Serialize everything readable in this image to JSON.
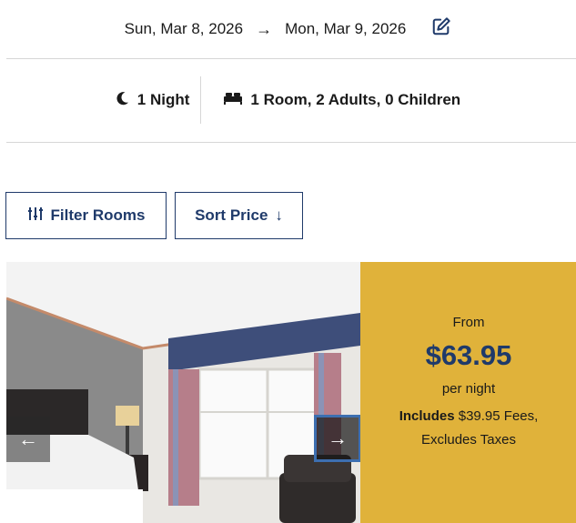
{
  "stay": {
    "check_in": "Sun, Mar 8, 2026",
    "arrow": "→",
    "check_out": "Mon, Mar 9, 2026",
    "edit_icon": "edit-icon"
  },
  "summary": {
    "nights": "1 Night",
    "guests": "1 Room, 2 Adults, 0 Children",
    "moon_icon": "moon-icon",
    "bed_icon": "bed-icon"
  },
  "toolbar": {
    "filter_label": "Filter Rooms",
    "sort_label": "Sort Price",
    "sort_arrow": "↓",
    "filter_icon": "sliders-icon"
  },
  "room": {
    "price_from": "From",
    "price": "$63.95",
    "per_night": "per night",
    "includes_label": "Includes",
    "fees_text": " $39.95 Fees,",
    "excludes_text": "Excludes Taxes",
    "prev_label": "←",
    "next_label": "→"
  },
  "colors": {
    "accent_navy": "#1f3a6a",
    "price_panel": "#e0b23a",
    "divider": "#d6d6d6"
  }
}
